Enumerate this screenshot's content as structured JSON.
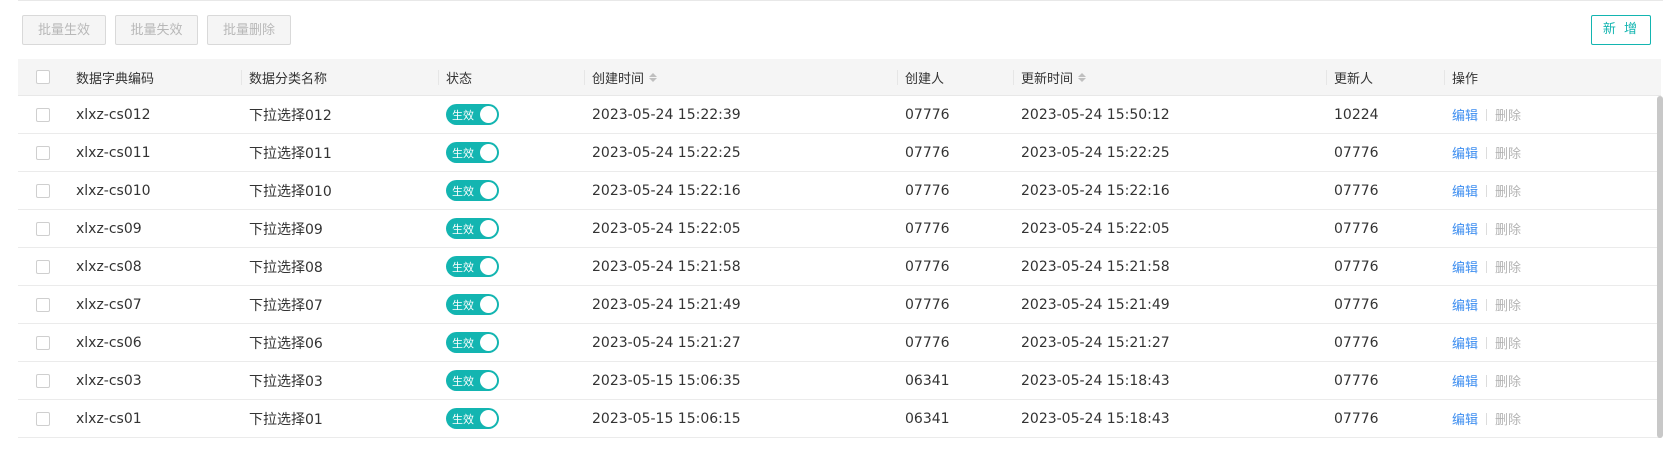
{
  "toolbar": {
    "batch_enable": "批量生效",
    "batch_disable": "批量失效",
    "batch_delete": "批量删除",
    "add": "新 增"
  },
  "table": {
    "columns": {
      "code": "数据字典编码",
      "name": "数据分类名称",
      "status": "状态",
      "created_time": "创建时间",
      "creator": "创建人",
      "updated_time": "更新时间",
      "updater": "更新人",
      "actions": "操作"
    },
    "rows": [
      {
        "code": "xlxz-cs012",
        "name": "下拉选择012",
        "status": "生效",
        "created_time": "2023-05-24 15:22:39",
        "creator": "07776",
        "updated_time": "2023-05-24 15:50:12",
        "updater": "10224",
        "edit": "编辑",
        "delete": "删除"
      },
      {
        "code": "xlxz-cs011",
        "name": "下拉选择011",
        "status": "生效",
        "created_time": "2023-05-24 15:22:25",
        "creator": "07776",
        "updated_time": "2023-05-24 15:22:25",
        "updater": "07776",
        "edit": "编辑",
        "delete": "删除"
      },
      {
        "code": "xlxz-cs010",
        "name": "下拉选择010",
        "status": "生效",
        "created_time": "2023-05-24 15:22:16",
        "creator": "07776",
        "updated_time": "2023-05-24 15:22:16",
        "updater": "07776",
        "edit": "编辑",
        "delete": "删除"
      },
      {
        "code": "xlxz-cs09",
        "name": "下拉选择09",
        "status": "生效",
        "created_time": "2023-05-24 15:22:05",
        "creator": "07776",
        "updated_time": "2023-05-24 15:22:05",
        "updater": "07776",
        "edit": "编辑",
        "delete": "删除"
      },
      {
        "code": "xlxz-cs08",
        "name": "下拉选择08",
        "status": "生效",
        "created_time": "2023-05-24 15:21:58",
        "creator": "07776",
        "updated_time": "2023-05-24 15:21:58",
        "updater": "07776",
        "edit": "编辑",
        "delete": "删除"
      },
      {
        "code": "xlxz-cs07",
        "name": "下拉选择07",
        "status": "生效",
        "created_time": "2023-05-24 15:21:49",
        "creator": "07776",
        "updated_time": "2023-05-24 15:21:49",
        "updater": "07776",
        "edit": "编辑",
        "delete": "删除"
      },
      {
        "code": "xlxz-cs06",
        "name": "下拉选择06",
        "status": "生效",
        "created_time": "2023-05-24 15:21:27",
        "creator": "07776",
        "updated_time": "2023-05-24 15:21:27",
        "updater": "07776",
        "edit": "编辑",
        "delete": "删除"
      },
      {
        "code": "xlxz-cs03",
        "name": "下拉选择03",
        "status": "生效",
        "created_time": "2023-05-15 15:06:35",
        "creator": "06341",
        "updated_time": "2023-05-24 15:18:43",
        "updater": "07776",
        "edit": "编辑",
        "delete": "删除"
      },
      {
        "code": "xlxz-cs01",
        "name": "下拉选择01",
        "status": "生效",
        "created_time": "2023-05-15 15:06:15",
        "creator": "06341",
        "updated_time": "2023-05-24 15:18:43",
        "updater": "07776",
        "edit": "编辑",
        "delete": "删除"
      }
    ]
  },
  "colors": {
    "accent": "#13b5b1",
    "link": "#3d8ef0",
    "disabled_text": "#b3b3b3"
  },
  "icons": [
    "sort-icon",
    "checkbox-icon"
  ]
}
